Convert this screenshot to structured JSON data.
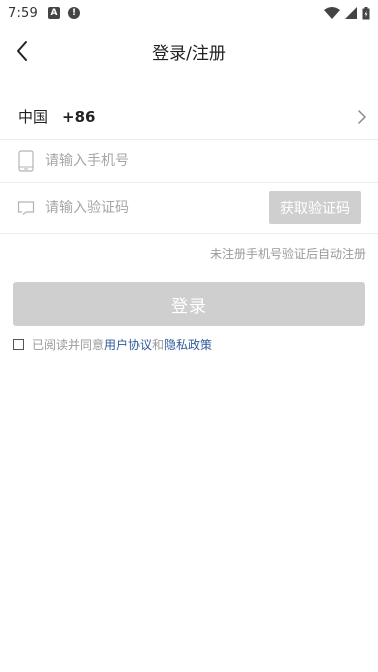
{
  "status_bar": {
    "time": "7:59",
    "notif_a": "A",
    "notif_alert": "!"
  },
  "nav": {
    "title": "登录/注册"
  },
  "country": {
    "name": "中国",
    "code": "+86"
  },
  "phone": {
    "placeholder": "请输入手机号",
    "value": ""
  },
  "code": {
    "placeholder": "请输入验证码",
    "value": "",
    "get_code_label": "获取验证码"
  },
  "hint": "未注册手机号验证后自动注册",
  "login_label": "登录",
  "agreement": {
    "checked": false,
    "prefix": "已阅读并同意",
    "terms": "用户协议",
    "conj": "和",
    "privacy": "隐私政策"
  },
  "colors": {
    "button_disabled": "#cfcfcf",
    "link": "#2f5a9c",
    "hint": "#9a9a9a"
  }
}
